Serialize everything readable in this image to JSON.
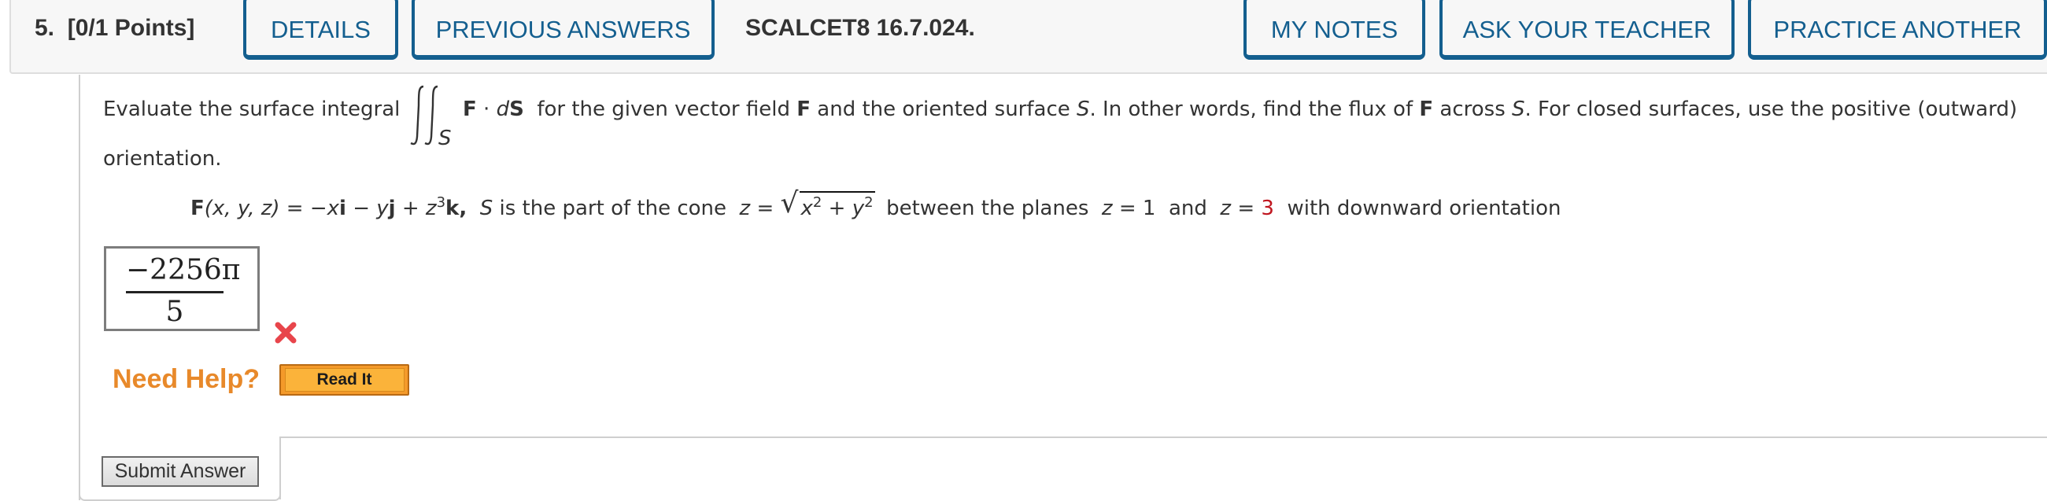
{
  "header": {
    "question_number": "5.",
    "points": "[0/1 Points]",
    "buttons": {
      "details": "DETAILS",
      "previous_answers": "PREVIOUS ANSWERS",
      "my_notes": "MY NOTES",
      "ask_your_teacher": "ASK YOUR TEACHER",
      "practice_another": "PRACTICE ANOTHER"
    },
    "question_code": "SCALCET8 16.7.024."
  },
  "question": {
    "line1_pre": "Evaluate the surface integral",
    "integral_subscript": "S",
    "integrand_F": "F",
    "integrand_dot": " · ",
    "integrand_d": "d",
    "integrand_S": "S",
    "line1_a": " for the given vector field ",
    "line1_F": "F",
    "line1_b": " and the oriented surface ",
    "line1_S": "S",
    "line1_c": ". In other words, find the flux of ",
    "line1_F2": "F",
    "line1_d": " across ",
    "line1_S2": "S",
    "line1_e": ". For closed surfaces, use the positive (outward)",
    "line2": "orientation.",
    "field": {
      "F": "F",
      "args": "(x, y, z)",
      "eq": " = −",
      "x": "x",
      "i": "i",
      "minus": " − ",
      "y": "y",
      "j": "j",
      "plus": " + ",
      "z": "z",
      "z_exp": "3",
      "k": "k",
      "comma": ",",
      "S": "S",
      "desc": " is the part of the cone ",
      "cone_z": "z",
      "cone_eq": " = ",
      "rad_x": "x",
      "rad_x_exp": "2",
      "rad_plus": " + ",
      "rad_y": "y",
      "rad_y_exp": "2",
      "between": " between the planes ",
      "z1_var": "z",
      "z1_eq": " = 1",
      "and": " and ",
      "z2_var": "z",
      "z2_eq": " = ",
      "z2_val": "3",
      "orientation": " with downward orientation"
    }
  },
  "answer": {
    "numerator": "−2256π",
    "denominator": "5",
    "status": "incorrect",
    "status_color": "#e8454b"
  },
  "help": {
    "label": "Need Help?",
    "read_it": "Read It"
  },
  "submit_label": "Submit Answer",
  "colors": {
    "accent": "#145f8f",
    "highlight_value": "#c0161f",
    "help_orange": "#e8892a"
  }
}
